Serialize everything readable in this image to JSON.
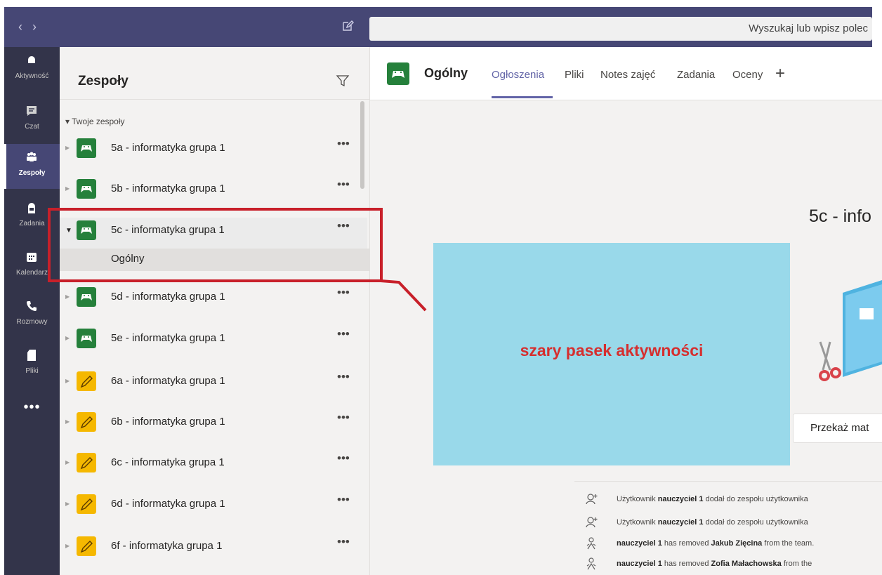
{
  "topbar": {
    "search_text": "Wyszukaj lub wpisz polec"
  },
  "rail": [
    {
      "label": "Aktywność",
      "icon": "bell-icon"
    },
    {
      "label": "Czat",
      "icon": "chat-icon"
    },
    {
      "label": "Zespoły",
      "icon": "teams-icon"
    },
    {
      "label": "Zadania",
      "icon": "assignments-icon"
    },
    {
      "label": "Kalendarz",
      "icon": "calendar-icon"
    },
    {
      "label": "Rozmowy",
      "icon": "phone-icon"
    },
    {
      "label": "Pliki",
      "icon": "file-icon"
    }
  ],
  "rail_more": "•••",
  "panel": {
    "title": "Zespoły",
    "section": "Twoje zespoły",
    "teams": [
      {
        "name": "5a - informatyka grupa 1",
        "avatar": "gamepad"
      },
      {
        "name": "5b - informatyka grupa 1",
        "avatar": "gamepad"
      },
      {
        "name": "5c - informatyka grupa 1",
        "avatar": "gamepad",
        "expanded": true
      },
      {
        "name": "5d - informatyka grupa 1",
        "avatar": "gamepad"
      },
      {
        "name": "5e - informatyka grupa 1",
        "avatar": "gamepad"
      },
      {
        "name": "6a - informatyka grupa 1",
        "avatar": "pencil"
      },
      {
        "name": "6b - informatyka grupa 1",
        "avatar": "pencil"
      },
      {
        "name": "6c - informatyka grupa 1",
        "avatar": "pencil"
      },
      {
        "name": "6d - informatyka grupa 1",
        "avatar": "pencil"
      },
      {
        "name": "6f - informatyka grupa 1",
        "avatar": "pencil"
      }
    ],
    "channel": "Ogólny",
    "more": "•••"
  },
  "main": {
    "channel_title": "Ogólny",
    "tabs": [
      "Ogłoszenia",
      "Pliki",
      "Notes zajęć",
      "Zadania",
      "Oceny"
    ],
    "add_tab": "+",
    "team_heading": "5c - info",
    "button_label": "Przekaż mat",
    "activity": [
      {
        "icon": "add-user-icon",
        "pre": "Użytkownik ",
        "bold": "nauczyciel 1",
        "post": " dodał do zespołu użytkownika"
      },
      {
        "icon": "add-user-icon",
        "pre": "Użytkownik ",
        "bold": "nauczyciel 1",
        "post": " dodał do zespołu użytkownika"
      },
      {
        "icon": "remove-user-icon",
        "pre": "",
        "bold": "nauczyciel 1",
        "post": " has removed ",
        "bold2": "Jakub Zięcina",
        "post2": " from the team."
      },
      {
        "icon": "remove-user-icon",
        "pre": "",
        "bold": "nauczyciel 1",
        "post": " has removed ",
        "bold2": "Zofia Małachowska",
        "post2": " from the"
      }
    ]
  },
  "annotation": {
    "text": "szary pasek aktywności"
  },
  "colors": {
    "topbar": "#464775",
    "rail": "#33344a",
    "accent": "#6264a7",
    "overlay": "#99d9ea",
    "annotation_red": "#c8202a"
  }
}
